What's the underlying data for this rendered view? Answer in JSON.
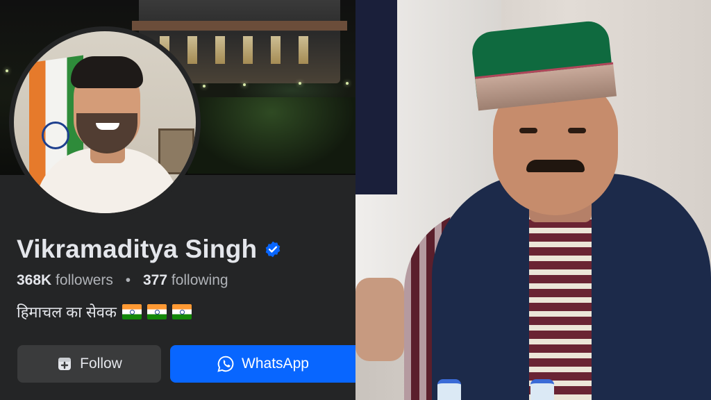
{
  "profile": {
    "name": "Vikramaditya Singh",
    "followers_count": "368K",
    "followers_label": "followers",
    "separator": "•",
    "following_count": "377",
    "following_label": "following",
    "bio": "हिमाचल का सेवक",
    "bio_flags_count": 3
  },
  "actions": {
    "follow_label": "Follow",
    "whatsapp_label": "WhatsApp"
  },
  "colors": {
    "background": "#242526",
    "primary_text": "#e4e6eb",
    "secondary_text": "#b0b3b8",
    "accent_blue": "#0866ff",
    "button_gray": "#3a3b3c",
    "verified_blue": "#0866ff"
  },
  "icons": {
    "verified": "verified-badge-icon",
    "follow": "add-friend-icon",
    "whatsapp": "whatsapp-icon"
  }
}
